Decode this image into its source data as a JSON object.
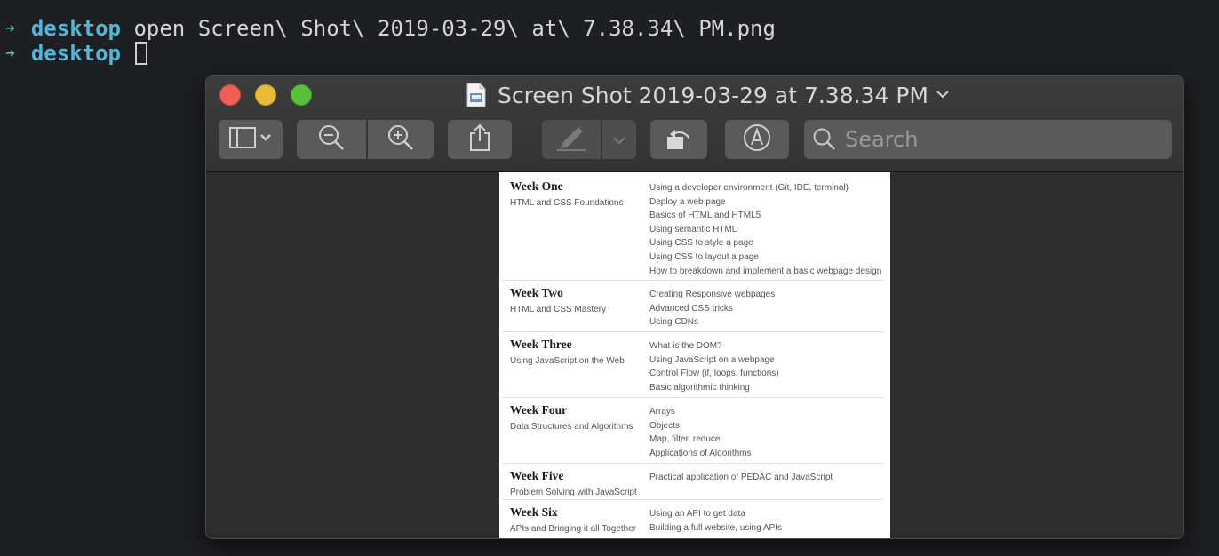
{
  "terminal": {
    "arrow": "➜",
    "dir": "desktop",
    "command": "open Screen\\ Shot\\ 2019-03-29\\ at\\ 7.38.34\\ PM.png"
  },
  "window": {
    "title": "Screen Shot 2019-03-29 at 7.38.34 PM",
    "search_placeholder": "Search",
    "colors": {
      "red": "#ee5e57",
      "yellow": "#e6bb3b",
      "green": "#5cbf3b"
    }
  },
  "toolbar_icons": [
    "sidebar-icon",
    "zoom-out-icon",
    "zoom-in-icon",
    "share-icon",
    "markup-pen-icon",
    "rotate-icon",
    "annotate-icon",
    "search-icon"
  ],
  "weeks": [
    {
      "title": "Week One",
      "subtitle": "HTML and CSS Foundations",
      "topics": [
        "Using a developer environment (Git, IDE, terminal)",
        "Deploy a web page",
        "Basics of HTML and HTML5",
        "Using semantic HTML",
        "Using CSS to style a page",
        "Using CSS to layout a page",
        "How to breakdown and implement a basic webpage design"
      ]
    },
    {
      "title": "Week Two",
      "subtitle": "HTML and CSS Mastery",
      "topics": [
        "Creating Responsive webpages",
        "Advanced CSS tricks",
        "Using CDNs"
      ]
    },
    {
      "title": "Week Three",
      "subtitle": "Using JavaScript on the Web",
      "topics": [
        "What is the DOM?",
        "Using JavaScript on a webpage",
        "Control Flow (if, loops, functions)",
        "Basic algorithmic thinking"
      ]
    },
    {
      "title": "Week Four",
      "subtitle": "Data Structures and Algorithms",
      "topics": [
        "Arrays",
        "Objects",
        "Map, filter, reduce",
        "Applications of Algorithms"
      ]
    },
    {
      "title": "Week Five",
      "subtitle": "Problem Solving with JavaScript",
      "topics": [
        "Practical application of PEDAC and JavaScript"
      ]
    },
    {
      "title": "Week Six",
      "subtitle": "APIs and Bringing it all Together",
      "topics": [
        "Using an API to get data",
        "Building a full website, using APIs"
      ]
    }
  ]
}
